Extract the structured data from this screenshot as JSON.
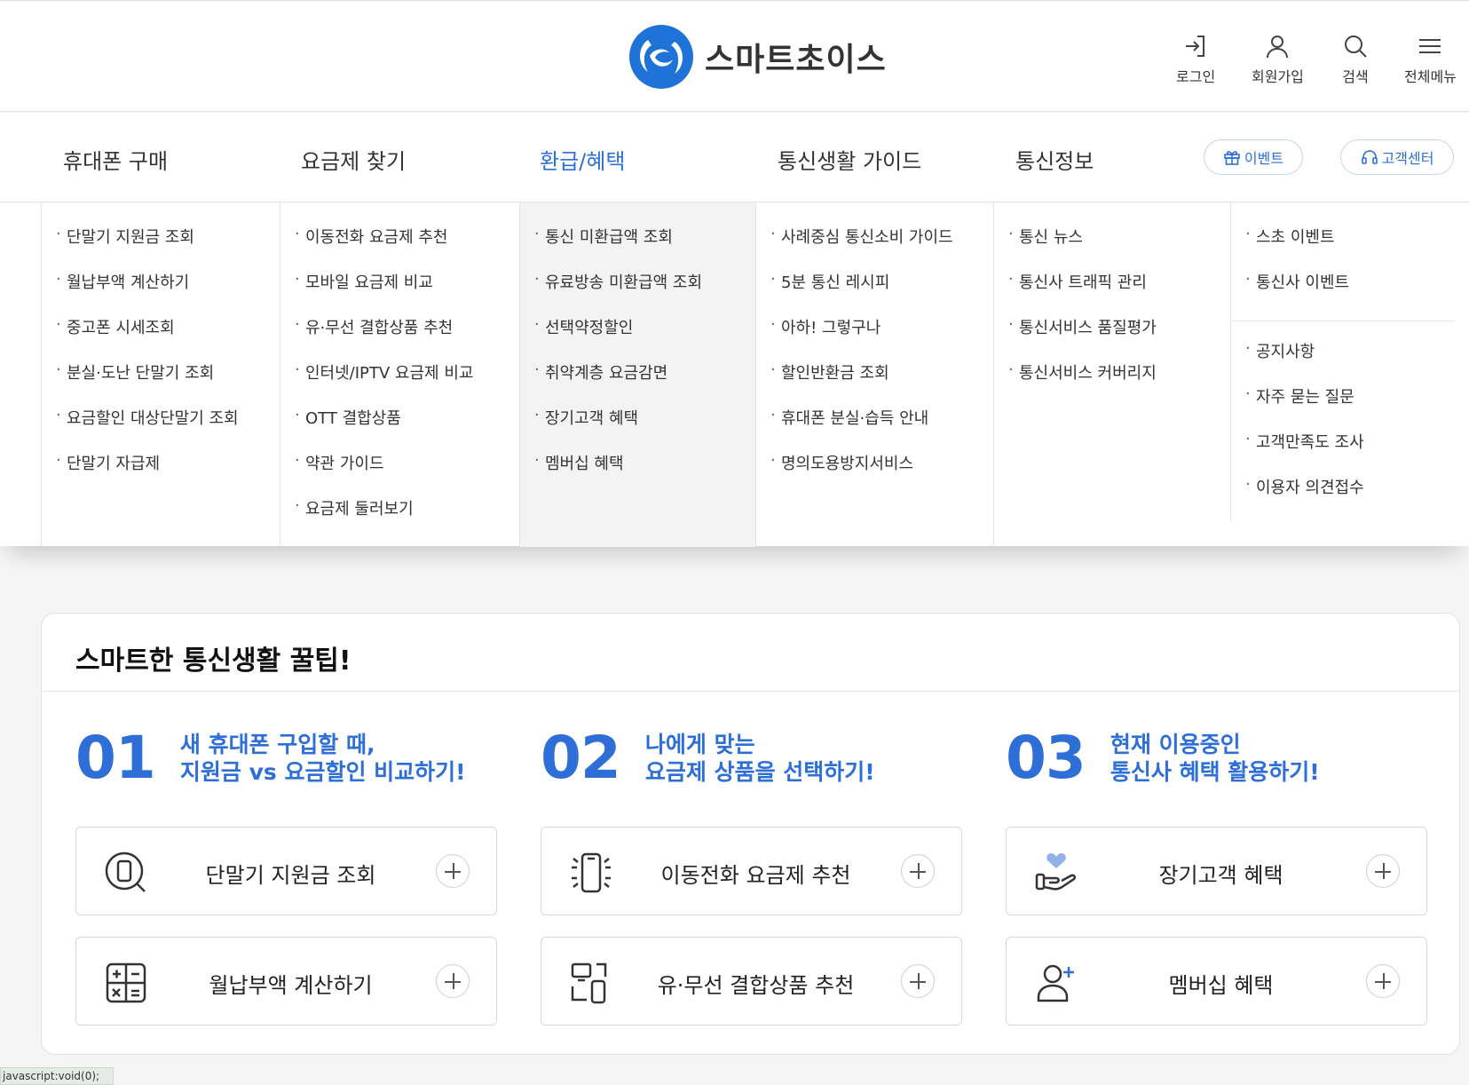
{
  "header": {
    "logo_text": "스마트초이스",
    "util": [
      {
        "label": "로그인",
        "icon": "login-icon"
      },
      {
        "label": "회원가입",
        "icon": "user-icon"
      },
      {
        "label": "검색",
        "icon": "search-icon"
      },
      {
        "label": "전체메뉴",
        "icon": "menu-icon"
      }
    ]
  },
  "nav": {
    "items": [
      "휴대폰 구매",
      "요금제 찾기",
      "환급/혜택",
      "통신생활 가이드",
      "통신정보"
    ],
    "active": "환급/혜택",
    "event_button": "이벤트",
    "cs_button": "고객센터"
  },
  "mega": {
    "col1": [
      "단말기 지원금 조회",
      "월납부액 계산하기",
      "중고폰 시세조회",
      "분실·도난 단말기 조회",
      "요금할인 대상단말기 조회",
      "단말기 자급제"
    ],
    "col2": [
      "이동전화 요금제 추천",
      "모바일 요금제 비교",
      "유·무선 결합상품 추천",
      "인터넷/IPTV 요금제 비교",
      "OTT 결합상품",
      "약관 가이드",
      "요금제 둘러보기"
    ],
    "col3": [
      "통신 미환급액 조회",
      "유료방송 미환급액 조회",
      "선택약정할인",
      "취약계층 요금감면",
      "장기고객 혜택",
      "멤버십 혜택"
    ],
    "col4": [
      "사례중심 통신소비 가이드",
      "5분 통신 레시피",
      "아하! 그렇구나",
      "할인반환금 조회",
      "휴대폰 분실·습득 안내",
      "명의도용방지서비스"
    ],
    "col5": [
      "통신 뉴스",
      "통신사 트래픽 관리",
      "통신서비스 품질평가",
      "통신서비스 커버리지"
    ],
    "col6a": [
      "스초 이벤트",
      "통신사 이벤트"
    ],
    "col6b": [
      "공지사항",
      "자주 묻는 질문",
      "고객만족도 조사",
      "이용자 의견접수"
    ]
  },
  "tips": {
    "title": "스마트한 통신생활 꿀팁!",
    "groups": [
      {
        "num": "01",
        "line1": "새 휴대폰 구입할 때,",
        "line2": "지원금 vs 요금할인 비교하기!",
        "cards": [
          {
            "label": "단말기 지원금 조회",
            "icon": "phone-search-icon"
          },
          {
            "label": "월납부액 계산하기",
            "icon": "calculator-icon"
          }
        ]
      },
      {
        "num": "02",
        "line1": "나에게 맞는",
        "line2": "요금제 상품을 선택하기!",
        "cards": [
          {
            "label": "이동전화 요금제 추천",
            "icon": "mobile-signal-icon"
          },
          {
            "label": "유·무선 결합상품 추천",
            "icon": "devices-icon"
          }
        ]
      },
      {
        "num": "03",
        "line1": "현재 이용중인",
        "line2": "통신사 혜택 활용하기!",
        "cards": [
          {
            "label": "장기고객 혜택",
            "icon": "heart-hand-icon"
          },
          {
            "label": "멤버십 혜택",
            "icon": "user-plus-icon"
          }
        ]
      }
    ]
  },
  "status_bar": "javascript:void(0);",
  "colors": {
    "accent": "#2d6fd6",
    "logo_blue": "#1f73d8",
    "background": "#f4f5f4"
  }
}
